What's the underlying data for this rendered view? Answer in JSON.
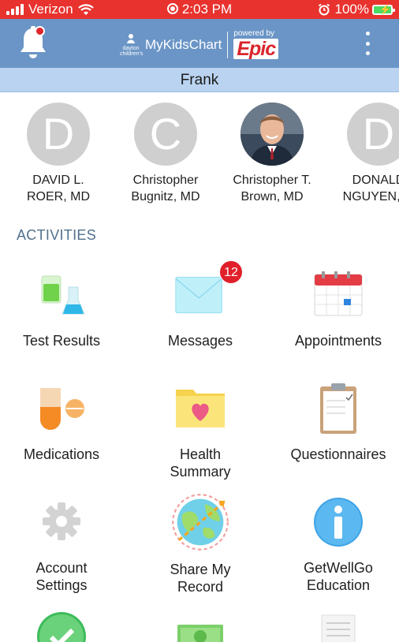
{
  "status_bar": {
    "carrier": "Verizon",
    "time": "2:03 PM",
    "battery_percent": "100%"
  },
  "header": {
    "brand_sub": "dayton children's",
    "app_name": "MyKidsChart",
    "powered_by": "powered by",
    "epic": "Epic",
    "notification_icon": "bell-icon",
    "menu_icon": "kebab-menu-icon"
  },
  "patient": {
    "name": "Frank"
  },
  "care_team": [
    {
      "initial": "D",
      "line1": "DAVID L.",
      "line2": "ROER, MD"
    },
    {
      "initial": "C",
      "line1": "Christopher",
      "line2": "Bugnitz, MD"
    },
    {
      "initial": "",
      "line1": "Christopher T.",
      "line2": "Brown, MD"
    },
    {
      "initial": "D",
      "line1": "DONALD",
      "line2": "NGUYEN, M"
    }
  ],
  "activities_title": "ACTIVITIES",
  "activities": [
    {
      "label": "Test Results",
      "icon": "test-results-icon"
    },
    {
      "label": "Messages",
      "icon": "messages-icon",
      "badge": "12"
    },
    {
      "label": "Appointments",
      "icon": "appointments-icon"
    },
    {
      "label_line1": "Medications",
      "label_line2": "",
      "icon": "medications-icon"
    },
    {
      "label_line1": "Health",
      "label_line2": "Summary",
      "icon": "health-summary-icon"
    },
    {
      "label_line1": "Questionnaires",
      "label_line2": "",
      "icon": "questionnaires-icon"
    },
    {
      "label_line1": "Account",
      "label_line2": "Settings",
      "icon": "account-settings-icon"
    },
    {
      "label_line1": "Share My",
      "label_line2": "Record",
      "icon": "share-my-record-icon"
    },
    {
      "label_line1": "GetWellGo",
      "label_line2": "Education",
      "icon": "education-icon"
    }
  ],
  "colors": {
    "status_bar": "#e8322e",
    "header": "#6a95c6",
    "patient_bar": "#b9d3f0",
    "section_title": "#51708d",
    "badge": "#e0202a"
  }
}
